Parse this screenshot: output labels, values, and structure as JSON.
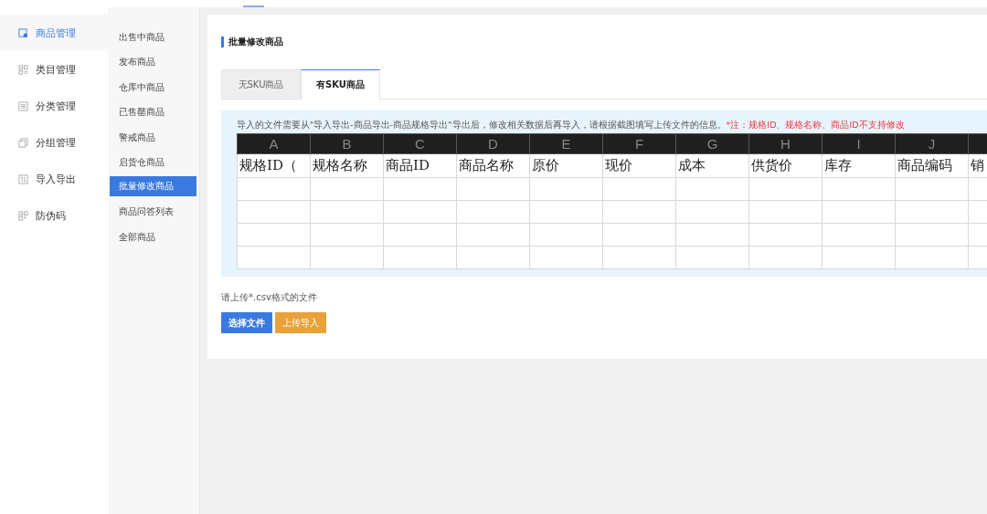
{
  "menu": [
    {
      "label": "商品管理",
      "selected": true
    },
    {
      "label": "类目管理",
      "selected": false
    },
    {
      "label": "分类管理",
      "selected": false
    },
    {
      "label": "分组管理",
      "selected": false
    },
    {
      "label": "导入导出",
      "selected": false
    },
    {
      "label": "防伪码",
      "selected": false
    }
  ],
  "submenu": [
    {
      "label": "出售中商品",
      "selected": false
    },
    {
      "label": "发布商品",
      "selected": false
    },
    {
      "label": "仓库中商品",
      "selected": false
    },
    {
      "label": "已售罄商品",
      "selected": false
    },
    {
      "label": "警戒商品",
      "selected": false
    },
    {
      "label": "启货仓商品",
      "selected": false
    },
    {
      "label": "批量修改商品",
      "selected": true
    },
    {
      "label": "商品问答列表",
      "selected": false
    },
    {
      "label": "全部商品",
      "selected": false
    }
  ],
  "page_title": "批量修改商品",
  "tabs": [
    {
      "label": "无SKU商品",
      "selected": false
    },
    {
      "label": "有SKU商品",
      "selected": true
    }
  ],
  "notice": {
    "text": "导入的文件需要从\"导入导出-商品导出-商品规格导出\"导出后，修改相关数据后再导入，请根据截图填写上传文件的信息。",
    "warning": "*注：规格ID、规格名称、商品ID不支持修改"
  },
  "sheet": {
    "columns": [
      {
        "letter": "A",
        "heading": "规格ID（"
      },
      {
        "letter": "B",
        "heading": "规格名称"
      },
      {
        "letter": "C",
        "heading": "商品ID"
      },
      {
        "letter": "D",
        "heading": "商品名称"
      },
      {
        "letter": "E",
        "heading": "原价"
      },
      {
        "letter": "F",
        "heading": "现价"
      },
      {
        "letter": "G",
        "heading": "成本"
      },
      {
        "letter": "H",
        "heading": "供货价"
      },
      {
        "letter": "I",
        "heading": "库存"
      },
      {
        "letter": "J",
        "heading": "商品编码"
      },
      {
        "heading": "销"
      }
    ],
    "rows": [
      {
        "kind": "blank"
      },
      {
        "kind": "blank"
      },
      {
        "kind": "blank"
      },
      {
        "kind": "blank"
      }
    ]
  },
  "upload_hint": "请上传*.csv格式的文件",
  "buttons": [
    {
      "label": "选择文件",
      "kind": "primary"
    },
    {
      "label": "上传导入",
      "kind": "warning"
    }
  ]
}
